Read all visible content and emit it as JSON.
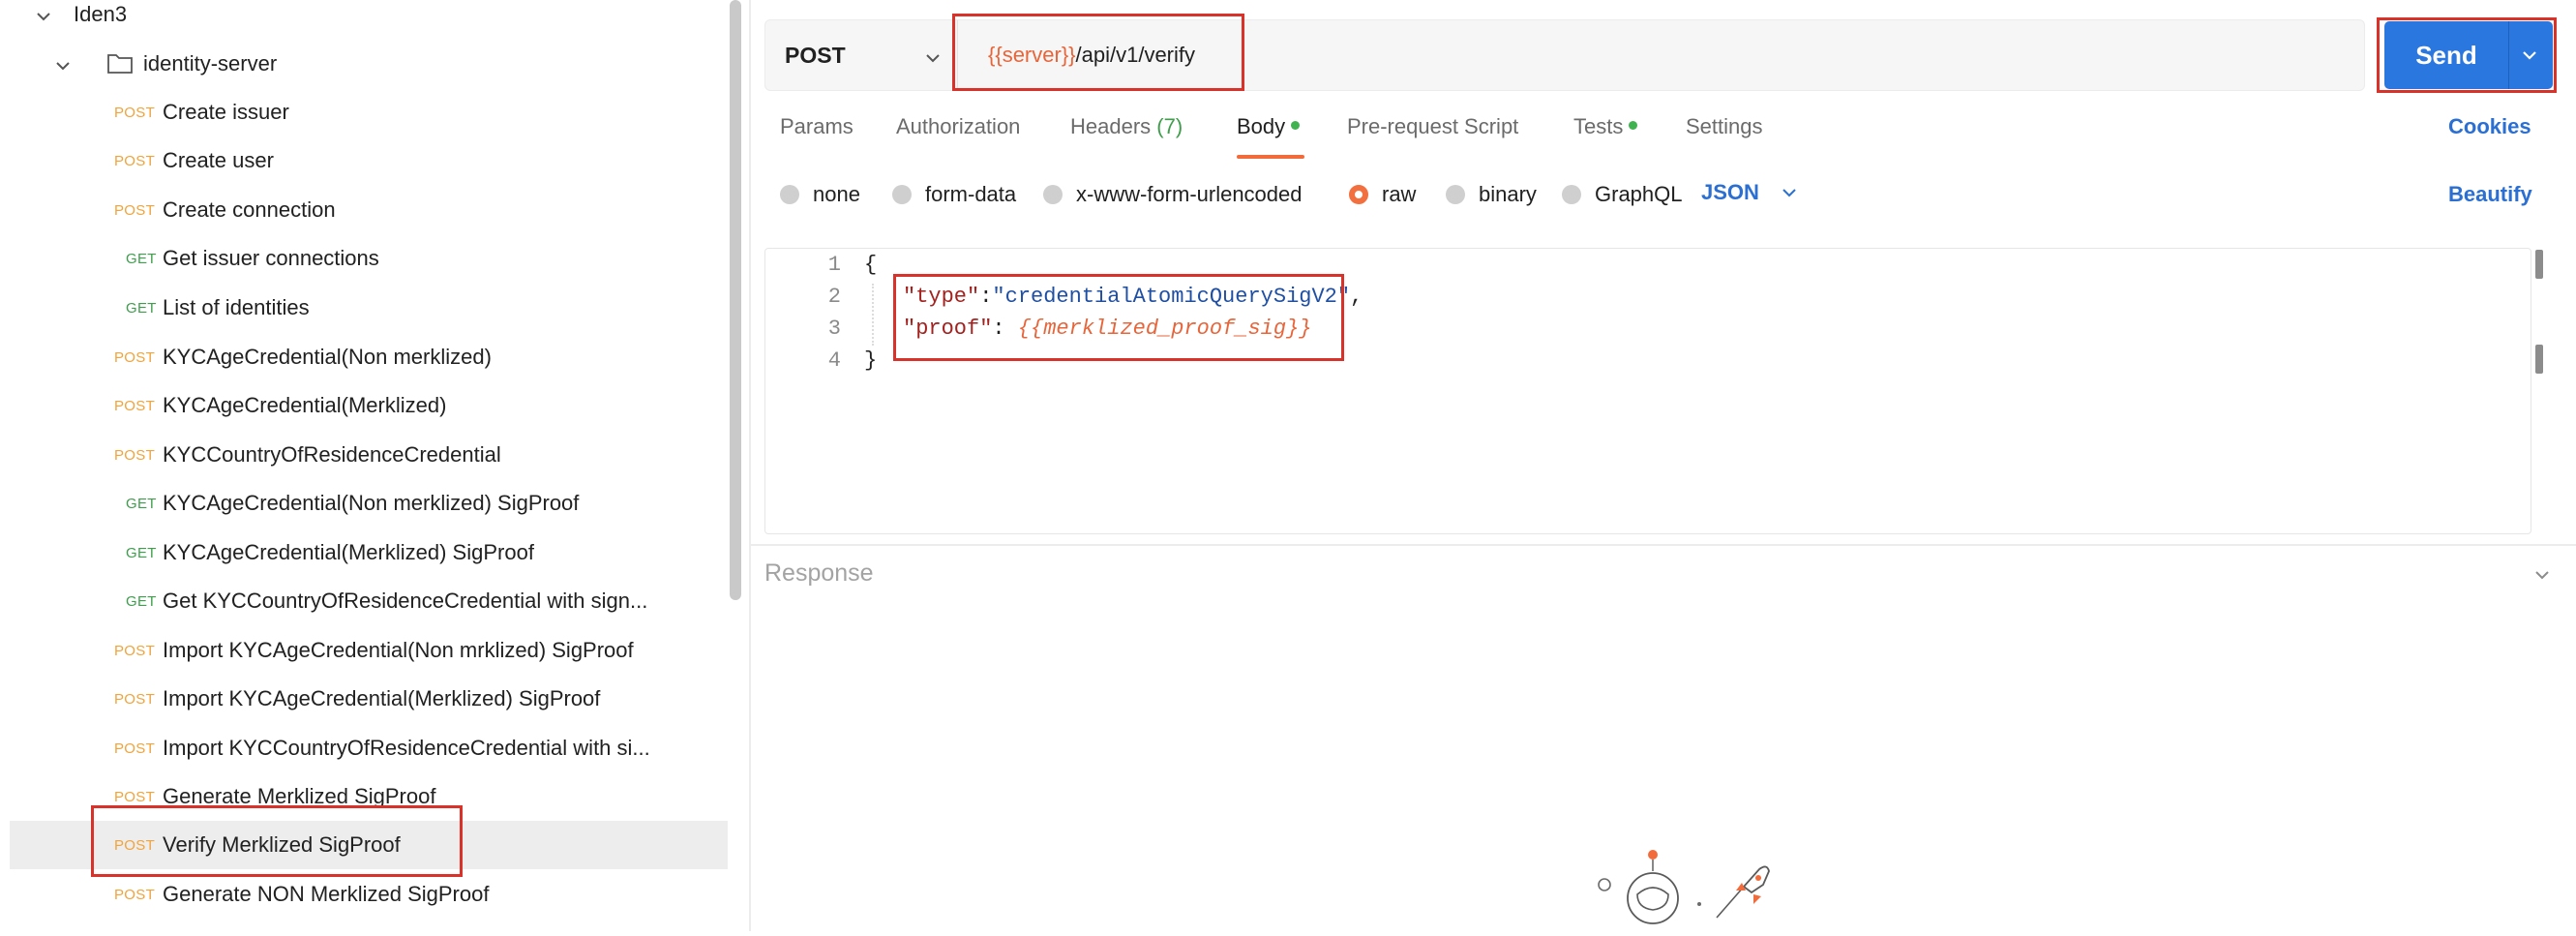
{
  "sidebar": {
    "folder_root": "Iden3",
    "folder_child": "identity-server",
    "requests": [
      {
        "method": "POST",
        "name": "Create issuer"
      },
      {
        "method": "POST",
        "name": "Create user"
      },
      {
        "method": "POST",
        "name": "Create connection"
      },
      {
        "method": "GET",
        "name": "Get issuer connections"
      },
      {
        "method": "GET",
        "name": "List of identities"
      },
      {
        "method": "POST",
        "name": "KYCAgeCredential(Non merklized)"
      },
      {
        "method": "POST",
        "name": "KYCAgeCredential(Merklized)"
      },
      {
        "method": "POST",
        "name": "KYCCountryOfResidenceCredential"
      },
      {
        "method": "GET",
        "name": "KYCAgeCredential(Non merklized) SigProof"
      },
      {
        "method": "GET",
        "name": "KYCAgeCredential(Merklized) SigProof"
      },
      {
        "method": "GET",
        "name": "Get KYCCountryOfResidenceCredential with sign..."
      },
      {
        "method": "POST",
        "name": "Import KYCAgeCredential(Non mrklized) SigProof"
      },
      {
        "method": "POST",
        "name": "Import KYCAgeCredential(Merklized) SigProof"
      },
      {
        "method": "POST",
        "name": "Import KYCCountryOfResidenceCredential with si..."
      },
      {
        "method": "POST",
        "name": "Generate Merklized SigProof"
      },
      {
        "method": "POST",
        "name": "Verify Merklized SigProof"
      },
      {
        "method": "POST",
        "name": "Generate NON Merklized SigProof"
      }
    ]
  },
  "request": {
    "method": "POST",
    "url_variable": "{{server}}",
    "url_path": "/api/v1/verify",
    "send_label": "Send"
  },
  "tabs": {
    "params": "Params",
    "authorization": "Authorization",
    "headers": "Headers",
    "headers_count": "(7)",
    "body": "Body",
    "prerequest": "Pre-request Script",
    "tests": "Tests",
    "settings": "Settings",
    "cookies": "Cookies"
  },
  "body_types": {
    "none": "none",
    "form_data": "form-data",
    "urlencoded": "x-www-form-urlencoded",
    "raw": "raw",
    "binary": "binary",
    "graphql": "GraphQL",
    "language": "JSON",
    "beautify": "Beautify",
    "selected": "raw"
  },
  "editor": {
    "line_numbers": [
      "1",
      "2",
      "3",
      "4"
    ],
    "open_brace": "{",
    "close_brace": "}",
    "key_type": "\"type\"",
    "value_type": "\"credentialAtomicQuerySigV2\"",
    "key_proof": "\"proof\"",
    "value_proof": "{{merklized_proof_sig}}",
    "colon": ":",
    "colon_space": ": ",
    "comma": ","
  },
  "response": {
    "label": "Response"
  },
  "colors": {
    "accent_blue": "#2a77e0",
    "highlight_red": "#d9322a",
    "post_orange": "#f2a33a",
    "get_green": "#3f9e4c"
  }
}
